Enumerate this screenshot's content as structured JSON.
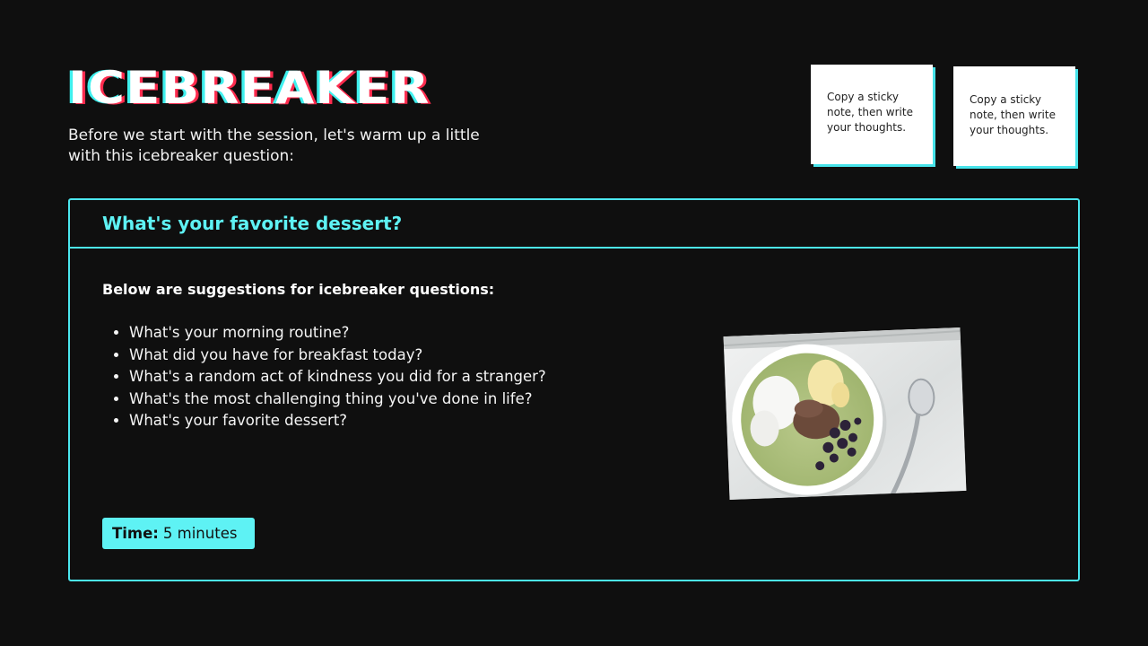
{
  "header": {
    "title": "ICEBREAKER",
    "subtitle": "Before we start with the session, let's warm up a little with this icebreaker question:"
  },
  "sticky_notes": [
    {
      "text": "Copy a sticky note, then write your thoughts."
    },
    {
      "text": "Copy a sticky note, then write your thoughts."
    }
  ],
  "card": {
    "question": "What's your favorite dessert?",
    "suggestions_heading": "Below are suggestions for icebreaker questions:",
    "suggestions": [
      "What's your morning routine?",
      "What did you have for breakfast today?",
      "What's a random act of kindness you did for a stranger?",
      "What's the most challenging thing you've done in life?",
      "What's your favorite dessert?"
    ],
    "time_label": "Time:",
    "time_value": "5 minutes"
  },
  "colors": {
    "background": "#0f0f0f",
    "accent_cyan": "#4be6ee",
    "accent_red": "#ff2b4e"
  }
}
